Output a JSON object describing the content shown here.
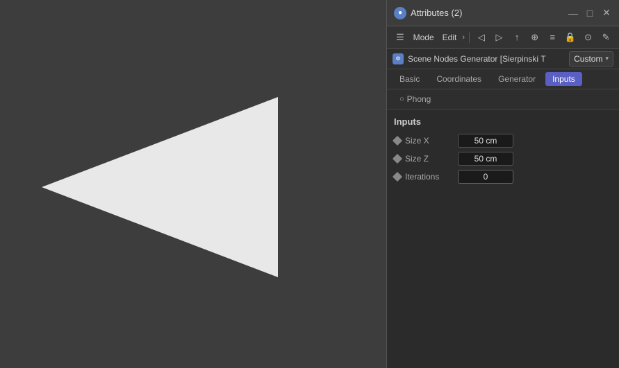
{
  "viewport": {
    "background": "#3d3d3d"
  },
  "panel": {
    "title": "Attributes (2)",
    "title_icon": "●",
    "controls": {
      "minimize": "—",
      "maximize": "□",
      "close": "✕"
    },
    "toolbar": {
      "menu_icon": "☰",
      "mode_label": "Mode",
      "edit_label": "Edit",
      "more_arrow": "›",
      "buttons": [
        "◁",
        "▷",
        "↑",
        "⊕",
        "≡",
        "🔒",
        "⊙",
        "✎"
      ]
    },
    "object_row": {
      "name": "Scene Nodes Generator [Sierpinski T",
      "custom_label": "Custom",
      "dropdown_arrow": "▾"
    },
    "tabs": [
      {
        "id": "basic",
        "label": "Basic",
        "active": false
      },
      {
        "id": "coordinates",
        "label": "Coordinates",
        "active": false
      },
      {
        "id": "generator",
        "label": "Generator",
        "active": false
      },
      {
        "id": "inputs",
        "label": "Inputs",
        "active": true
      }
    ],
    "subtabs": [
      {
        "id": "phong",
        "label": "Phong",
        "icon": "○"
      }
    ],
    "content": {
      "section_title": "Inputs",
      "fields": [
        {
          "id": "size-x",
          "label": "Size X",
          "value": "50 cm"
        },
        {
          "id": "size-z",
          "label": "Size Z",
          "value": "50 cm"
        },
        {
          "id": "iterations",
          "label": "Iterations",
          "value": "0"
        }
      ]
    }
  }
}
